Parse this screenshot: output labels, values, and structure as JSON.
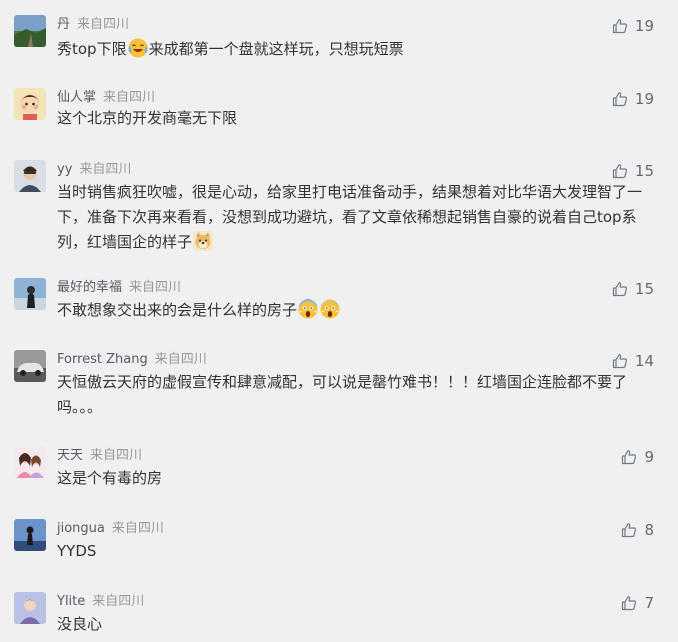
{
  "accent_color": "#576b95",
  "comments": [
    {
      "user": "丹",
      "location": "来自四川",
      "text_before": "秀top下限",
      "emoji": "laughing-tears",
      "text_after": "来成都第一个盘就这样玩，只想玩短票",
      "likes": "19",
      "like_icon": "thumb-up-icon"
    },
    {
      "user": "仙人掌",
      "location": "来自四川",
      "text": "这个北京的开发商毫无下限",
      "likes": "19",
      "like_icon": "thumb-up-icon"
    },
    {
      "user": "yy",
      "location": "来自四川",
      "text_before": "当时销售疯狂吹嘘，很是心动，给家里打电话准备动手，结果想着对比华语大发理智了一下，准备下次再来看看，没想到成功避坑，看了文章依稀想起销售自豪的说着自己top系列，红墙国企的样子",
      "emoji": "doge",
      "text_after": "",
      "likes": "15",
      "like_icon": "thumb-up-icon"
    },
    {
      "user": "最好的幸福",
      "location": "来自四川",
      "text_before": "不敢想象交出来的会是什么样的房子",
      "emoji": "scream",
      "emoji_count": 2,
      "text_after": "",
      "likes": "15",
      "like_icon": "thumb-up-icon"
    },
    {
      "user": "Forrest Zhang",
      "location": "来自四川",
      "text": "天恒傲云天府的虚假宣传和肆意减配，可以说是罄竹难书！！！红墙国企连脸都不要了吗。。。",
      "likes": "14",
      "like_icon": "thumb-up-icon"
    },
    {
      "user": "天天",
      "location": "来自四川",
      "text": "这是个有毒的房",
      "likes": "9",
      "like_icon": "thumb-up-icon"
    },
    {
      "user": "jiongua",
      "location": "来自四川",
      "text": "YYDS",
      "likes": "8",
      "like_icon": "thumb-up-icon"
    },
    {
      "user": "Ylite",
      "location": "来自四川",
      "text": "没良心",
      "likes": "7",
      "like_icon": "thumb-up-icon"
    }
  ]
}
